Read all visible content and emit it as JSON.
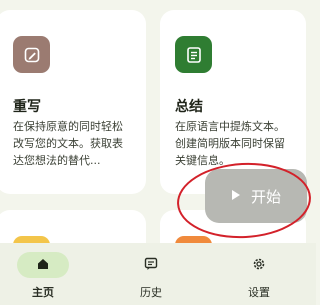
{
  "cards": [
    {
      "title": "重写",
      "icon": "edit-pen-icon",
      "description": "在保持原意的同时轻松改写您的文本。获取表达您想法的替代...",
      "icon_color": "#9b7b71"
    },
    {
      "title": "总结",
      "icon": "document-summary-icon",
      "description": "在原语言中提炼文本。创建简明版本同时保留关键信息。",
      "icon_color": "#2f7d32"
    }
  ],
  "start_button": {
    "label": "开始",
    "icon": "play-icon"
  },
  "bottom_nav": {
    "items": [
      {
        "label": "主页",
        "icon": "home-icon",
        "active": true
      },
      {
        "label": "历史",
        "icon": "history-icon",
        "active": false
      },
      {
        "label": "设置",
        "icon": "gear-icon",
        "active": false
      }
    ]
  },
  "colors": {
    "background": "#f3f5ec",
    "active_nav_pill": "#d6ebc3",
    "annotation_ring": "#d3212a"
  }
}
